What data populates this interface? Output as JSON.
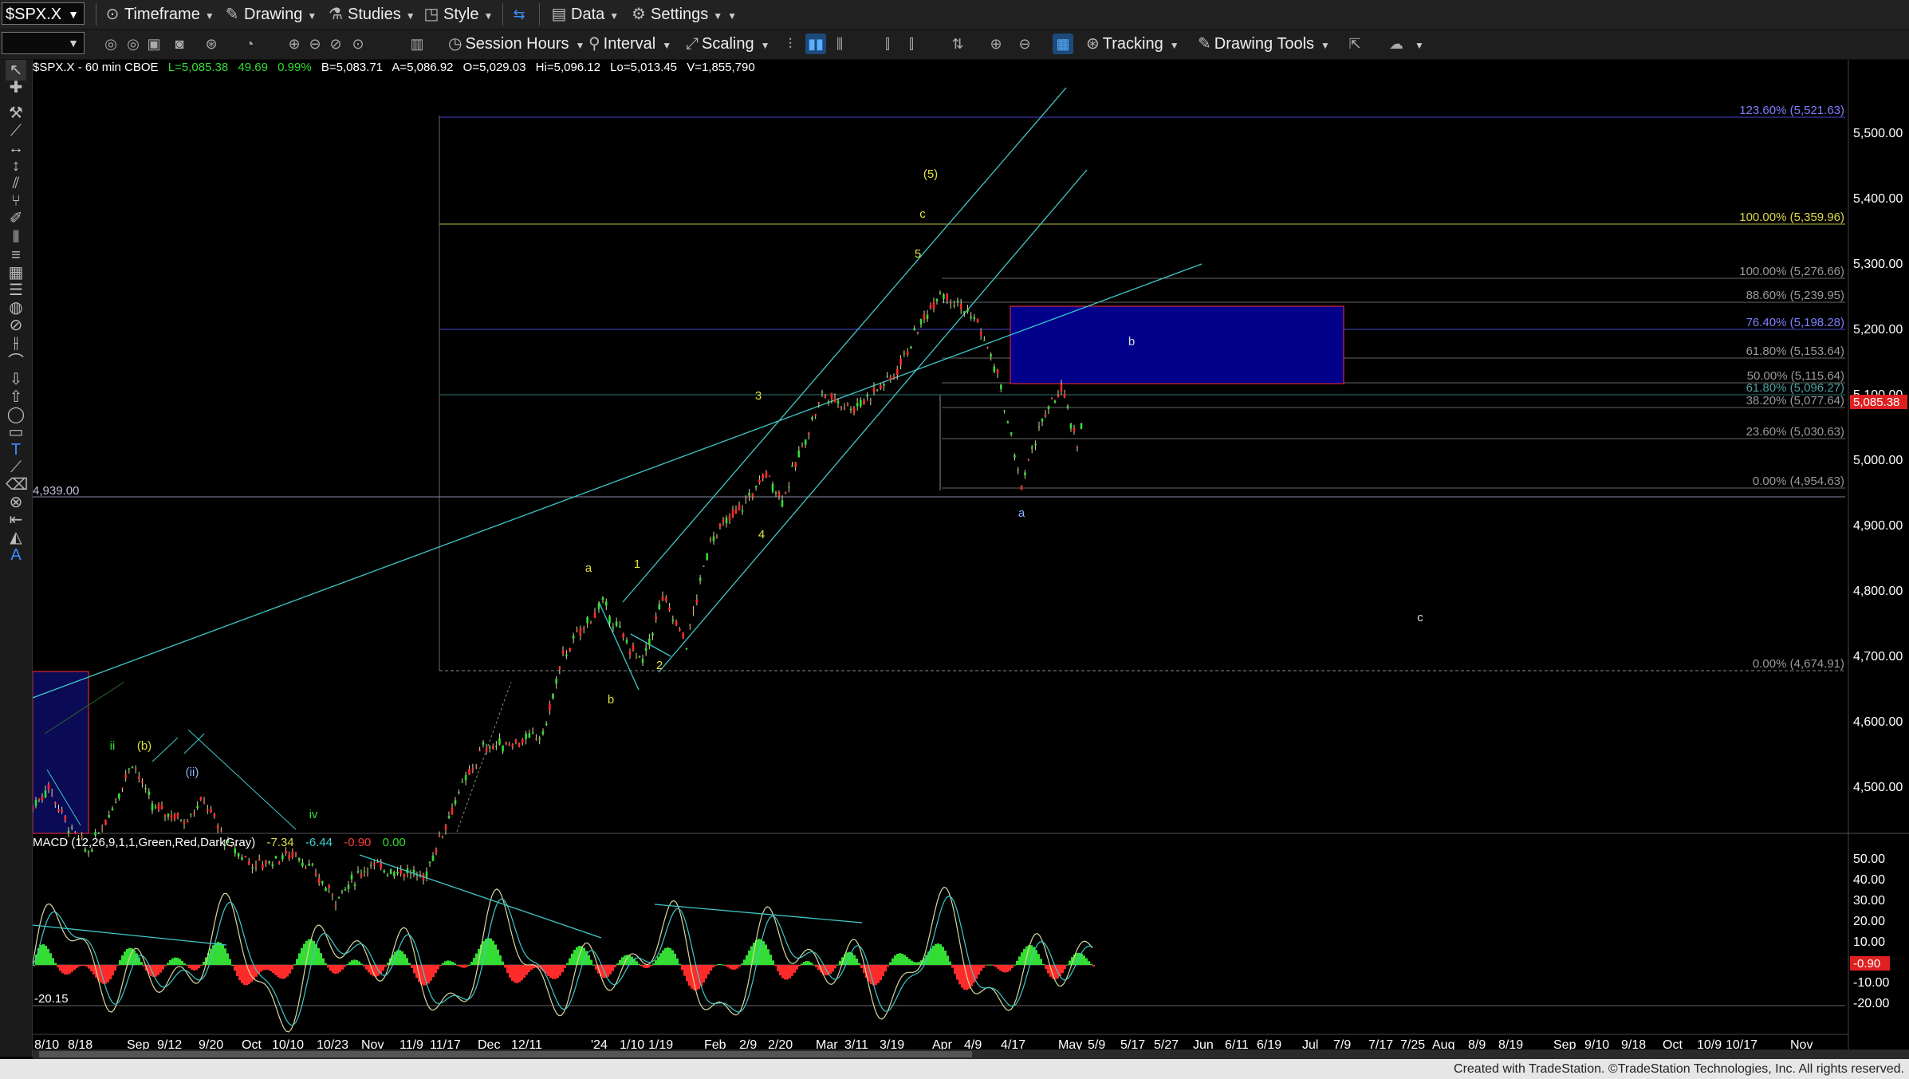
{
  "toolbar": {
    "symbol": "$SPX.X",
    "menus": [
      {
        "label": "Timeframe",
        "icon": "timeframe-icon"
      },
      {
        "label": "Drawing",
        "icon": "drawing-icon"
      },
      {
        "label": "Studies",
        "icon": "studies-icon"
      },
      {
        "label": "Style",
        "icon": "style-icon"
      },
      {
        "label": "Data",
        "icon": "data-icon"
      },
      {
        "label": "Settings",
        "icon": "settings-gear-icon"
      }
    ],
    "session_hours": "Session Hours",
    "interval": "Interval",
    "scaling": "Scaling",
    "tracking": "Tracking",
    "drawing_tools": "Drawing Tools"
  },
  "header": {
    "symbol_line": "$SPX.X - 60 min  CBOE",
    "last": "L=5,085.38",
    "change": "49.69",
    "pct": "0.99%",
    "bid": "B=5,083.71",
    "ask": "A=5,086.92",
    "open": "O=5,029.03",
    "high": "Hi=5,096.12",
    "low": "Lo=5,013.45",
    "volume": "V=1,855,790"
  },
  "price_axis": {
    "ticks": [
      "5,500.00",
      "5,400.00",
      "5,300.00",
      "5,200.00",
      "5,100.00",
      "5,000.00",
      "4,900.00",
      "4,800.00",
      "4,700.00",
      "4,600.00",
      "4,500.00"
    ],
    "last_label": "5,085.38"
  },
  "fib_labels": [
    {
      "text": "123.60% (5,521.63)",
      "color": "#7f7fff"
    },
    {
      "text": "100.00% (5,359.96)",
      "color": "#d8d84a"
    },
    {
      "text": "100.00% (5,276.66)",
      "color": "#9a9a9a"
    },
    {
      "text": "88.60% (5,239.95)",
      "color": "#9a9a9a"
    },
    {
      "text": "76.40% (5,198.28)",
      "color": "#7f7fff"
    },
    {
      "text": "61.80% (5,153.64)",
      "color": "#9a9a9a"
    },
    {
      "text": "50.00% (5,115.64)",
      "color": "#9a9a9a"
    },
    {
      "text": "61.80% (5,096.27)",
      "color": "#4fa0a0"
    },
    {
      "text": "38.20% (5,077.64)",
      "color": "#9a9a9a"
    },
    {
      "text": "23.60% (5,030.63)",
      "color": "#9a9a9a"
    },
    {
      "text": "0.00% (4,954.63)",
      "color": "#9a9a9a"
    },
    {
      "text": "0.00% (4,674.91)",
      "color": "#9a9a9a"
    }
  ],
  "left_level": "4,939.00",
  "wave_labels": [
    {
      "text": "(5)",
      "color": "#e0e040"
    },
    {
      "text": "c",
      "color": "#e0e040"
    },
    {
      "text": "5",
      "color": "#e0e040"
    },
    {
      "text": "3",
      "color": "#e0e040"
    },
    {
      "text": "4",
      "color": "#e0e040"
    },
    {
      "text": "1",
      "color": "#e0e040"
    },
    {
      "text": "2",
      "color": "#e0e040"
    },
    {
      "text": "a",
      "color": "#e0e040"
    },
    {
      "text": "b",
      "color": "#e0e040"
    },
    {
      "text": "b",
      "color": "#dddddd"
    },
    {
      "text": "a",
      "color": "#8fb0ff"
    },
    {
      "text": "c",
      "color": "#dddddd"
    },
    {
      "text": "ii",
      "color": "#33dd33"
    },
    {
      "text": "(b)",
      "color": "#e0e040"
    },
    {
      "text": "(ii)",
      "color": "#8fb0ff"
    },
    {
      "text": "iv",
      "color": "#33dd33"
    }
  ],
  "macd": {
    "label": "MACD (12,26,9,1,1,Green,Red,DarkGray)",
    "values": [
      {
        "text": "-7.34",
        "color": "#e0e040"
      },
      {
        "text": "-6.44",
        "color": "#40d0d0"
      },
      {
        "text": "-0.90",
        "color": "#ff3b3b"
      },
      {
        "text": "0.00",
        "color": "#33dd33"
      }
    ],
    "axis_ticks": [
      "50.00",
      "40.00",
      "30.00",
      "20.00",
      "10.00",
      "0.00",
      "-10.00",
      "-20.00"
    ],
    "current_label": "-0.90",
    "left_value": "-20.15"
  },
  "time_axis": [
    "8/10",
    "8/18",
    "Sep",
    "9/12",
    "9/20",
    "Oct",
    "10/10",
    "10/23",
    "Nov",
    "11/9",
    "11/17",
    "Dec",
    "12/11",
    "'24",
    "1/10",
    "1/19",
    "Feb",
    "2/9",
    "2/20",
    "Mar",
    "3/11",
    "3/19",
    "Apr",
    "4/9",
    "4/17",
    "May",
    "5/9",
    "5/17",
    "5/27",
    "Jun",
    "6/11",
    "6/19",
    "Jul",
    "7/9",
    "7/17",
    "7/25",
    "Aug",
    "8/9",
    "8/19",
    "Sep",
    "9/10",
    "9/18",
    "Oct",
    "10/9",
    "10/17",
    "Nov"
  ],
  "footer": "Created with TradeStation. ©TradeStation Technologies, Inc. All rights reserved.",
  "colors": {
    "up": "#33dd33",
    "down": "#ff2a2a",
    "candle_line": "#d8d8a0",
    "channel": "#40c8c8",
    "box_fill": "#00008b",
    "box_edge": "#ff3030"
  },
  "chart_data": {
    "type": "line",
    "title": "$SPX.X - 60 min",
    "x": [
      "8/10",
      "Sep",
      "Oct",
      "Nov",
      "Dec",
      "'24",
      "Feb",
      "Mar",
      "Apr",
      "4/17",
      "May"
    ],
    "series": [
      {
        "values": [
          4480,
          4530,
          4420,
          4430,
          4600,
          4780,
          4900,
          5100,
          5260,
          4960,
          5085
        ]
      }
    ],
    "ylim": [
      4400,
      5560
    ],
    "ylabel": "",
    "xlabel": ""
  }
}
